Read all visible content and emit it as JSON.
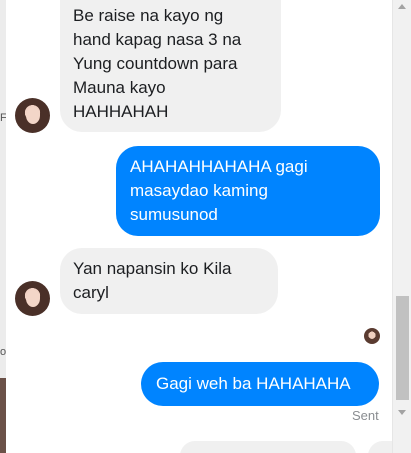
{
  "messages": [
    {
      "direction": "incoming",
      "lines": [
        "Be raise na kayo ng",
        "hand kapag nasa 3 na",
        "Yung countdown para",
        "Mauna kayo",
        "HAHHAHAH"
      ]
    },
    {
      "direction": "outgoing",
      "lines": [
        "AHAHAHHAHAHA gagi",
        "masaydao kaming",
        "sumusunod"
      ]
    },
    {
      "direction": "incoming",
      "lines": [
        "Yan napansin ko Kila",
        "caryl"
      ]
    },
    {
      "direction": "outgoing",
      "lines": [
        "Gagi weh ba HAHAHAHA"
      ]
    }
  ],
  "status": {
    "sent_label": "Sent"
  },
  "left_edge": {
    "char_top": "F",
    "char_bottom": "o"
  },
  "colors": {
    "outgoing_bubble": "#0084ff",
    "incoming_bubble": "#f0f0f0"
  },
  "icons": {
    "avatar": "contact-avatar-icon",
    "read_receipt": "seen-avatar-icon"
  }
}
